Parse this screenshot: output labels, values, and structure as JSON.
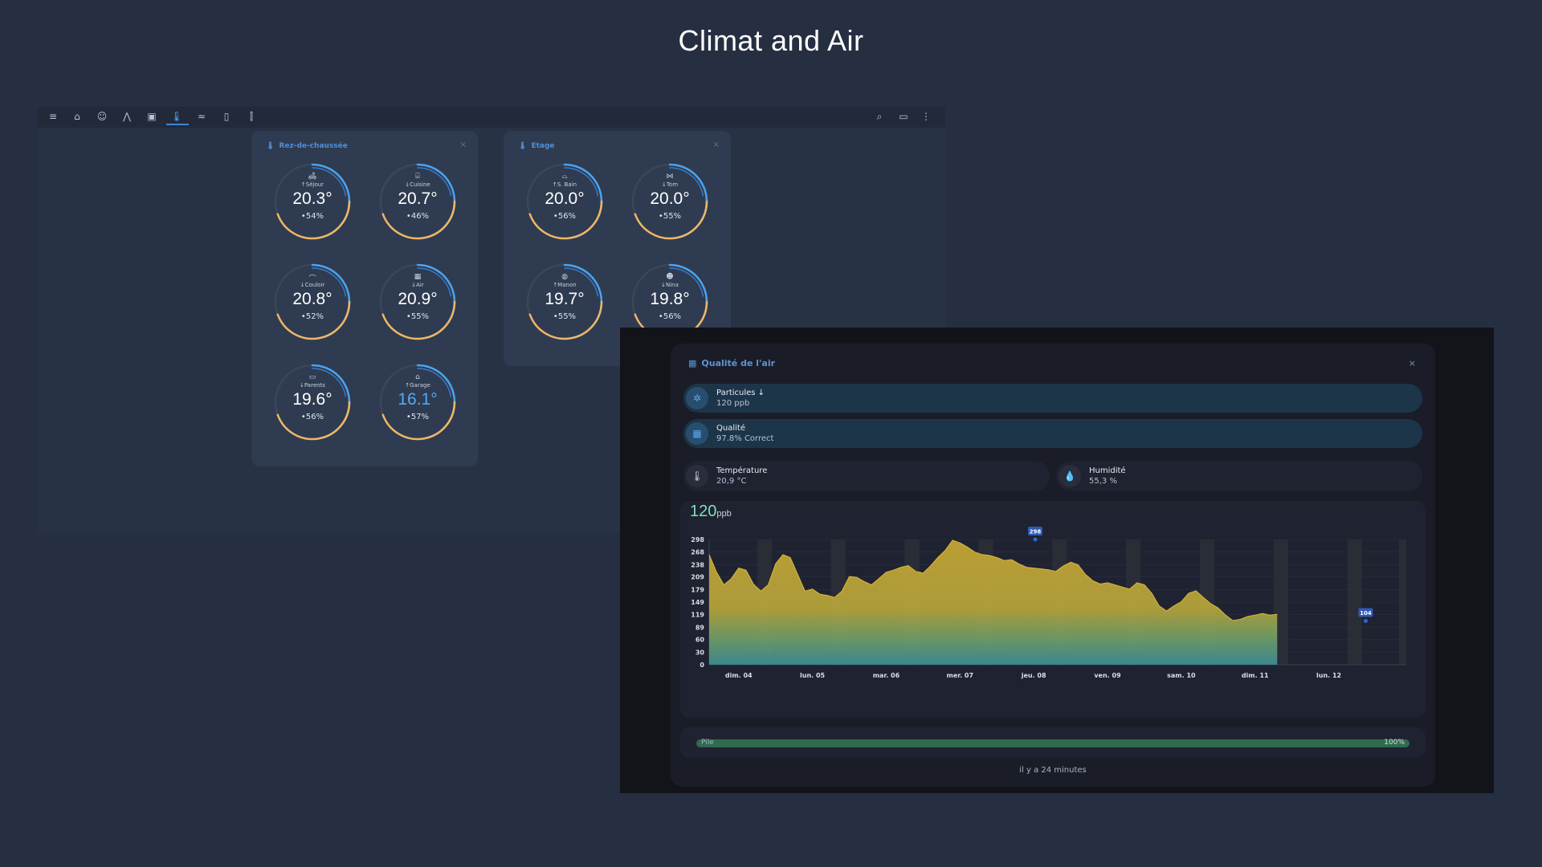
{
  "page_title": "Climat and Air",
  "toolbar": {
    "left_icons": [
      "menu-icon",
      "home-icon",
      "person-icon",
      "road-icon",
      "washing-machine-icon",
      "thermometer-icon",
      "wave-icon",
      "door-icon",
      "test-tube-icon"
    ],
    "right_icons": [
      "search-icon",
      "chat-icon",
      "dots-vertical-icon"
    ],
    "active_index": 5
  },
  "cards": [
    {
      "title": "Rez-de-chaussée",
      "rooms": [
        {
          "icon": "sofa",
          "label": "↑Séjour",
          "temp": "20.3°",
          "humidity": "54%"
        },
        {
          "icon": "stove",
          "label": "↓Cuisine",
          "temp": "20.7°",
          "humidity": "46%"
        },
        {
          "icon": "coat-hanger",
          "label": "↓Couloir",
          "temp": "20.8°",
          "humidity": "52%"
        },
        {
          "icon": "air-filter",
          "label": "↓Air",
          "temp": "20.9°",
          "humidity": "55%"
        },
        {
          "icon": "bed",
          "label": "↓Parents",
          "temp": "19.6°",
          "humidity": "56%"
        },
        {
          "icon": "garage",
          "label": "↑Garage",
          "temp": "16.1°",
          "humidity": "57%"
        }
      ]
    },
    {
      "title": "Etage",
      "rooms": [
        {
          "icon": "bathtub",
          "label": "↑S. Bain",
          "temp": "20.0°",
          "humidity": "56%"
        },
        {
          "icon": "bow-tie",
          "label": "↓Tom",
          "temp": "20.0°",
          "humidity": "55%"
        },
        {
          "icon": "basketball",
          "label": "↑Manon",
          "temp": "19.7°",
          "humidity": "55%"
        },
        {
          "icon": "cat",
          "label": "↓Nina",
          "temp": "19.8°",
          "humidity": "56%"
        }
      ]
    }
  ],
  "dialog": {
    "title": "Qualité de l'air",
    "tiles": [
      {
        "icon": "molecule-icon",
        "name": "Particules ↓",
        "value": "120 ppb"
      },
      {
        "icon": "air-filter-icon",
        "name": "Qualité",
        "value": "97.8% Correct"
      },
      {
        "icon": "thermometer-icon",
        "name": "Température",
        "value": "20,9 °C"
      },
      {
        "icon": "water-icon",
        "name": "Humidité",
        "value": "55,3 %"
      }
    ],
    "current_value": "120",
    "current_unit": "ppb",
    "battery": {
      "label": "Pile",
      "percent_text": "100%",
      "level": 1.0
    },
    "updated": "il y a 24 minutes"
  },
  "chart_data": {
    "type": "area",
    "title": "",
    "xlabel": "",
    "ylabel": "",
    "y_ticks": [
      "298",
      "268",
      "238",
      "209",
      "179",
      "149",
      "119",
      "89",
      "60",
      "30",
      "0"
    ],
    "ylim": [
      0,
      298
    ],
    "x_ticks": [
      "dim. 04",
      "lun. 05",
      "mar. 06",
      "mer. 07",
      "jeu. 08",
      "ven. 09",
      "sam. 10",
      "dim. 11",
      "lun. 12"
    ],
    "x_range_days": [
      3.6,
      13.05
    ],
    "x": [
      3.6,
      3.7,
      3.8,
      3.9,
      4.0,
      4.1,
      4.2,
      4.3,
      4.4,
      4.5,
      4.6,
      4.7,
      4.8,
      4.9,
      5.0,
      5.1,
      5.2,
      5.3,
      5.4,
      5.5,
      5.6,
      5.7,
      5.8,
      5.9,
      6.0,
      6.1,
      6.2,
      6.3,
      6.4,
      6.5,
      6.6,
      6.7,
      6.8,
      6.9,
      7.0,
      7.1,
      7.2,
      7.3,
      7.4,
      7.5,
      7.6,
      7.7,
      7.8,
      7.9,
      8.0,
      8.1,
      8.2,
      8.3,
      8.4,
      8.5,
      8.6,
      8.7,
      8.8,
      8.9,
      9.0,
      9.1,
      9.2,
      9.3,
      9.4,
      9.5,
      9.6,
      9.7,
      9.8,
      9.9,
      10.0,
      10.1,
      10.2,
      10.3,
      10.4,
      10.5,
      10.6,
      10.7,
      10.8,
      10.9,
      11.0,
      11.1,
      11.2,
      11.3,
      11.4,
      11.5,
      11.6,
      11.7,
      11.8,
      11.9,
      12.0,
      12.1,
      12.2,
      12.3,
      12.4,
      12.5,
      12.6,
      12.7,
      12.8,
      12.9,
      13.0,
      13.05
    ],
    "series": [
      {
        "values": [
          262,
          220,
          190,
          205,
          230,
          225,
          192,
          175,
          190,
          240,
          262,
          255,
          215,
          175,
          180,
          168,
          165,
          160,
          175,
          210,
          208,
          198,
          190,
          205,
          220,
          225,
          232,
          236,
          222,
          218,
          235,
          255,
          272,
          296,
          290,
          280,
          268,
          262,
          260,
          255,
          248,
          250,
          240,
          232,
          230,
          228,
          226,
          222,
          235,
          244,
          238,
          215,
          200,
          192,
          195,
          190,
          185,
          180,
          195,
          190,
          170,
          140,
          128,
          140,
          150,
          170,
          176,
          160,
          145,
          135,
          118,
          105,
          108,
          115,
          118,
          122,
          118,
          120
        ]
      }
    ],
    "annotations": [
      {
        "x": 8.02,
        "y": 298,
        "text": "298"
      },
      {
        "x": 12.5,
        "y": 104,
        "text": "104"
      }
    ]
  }
}
